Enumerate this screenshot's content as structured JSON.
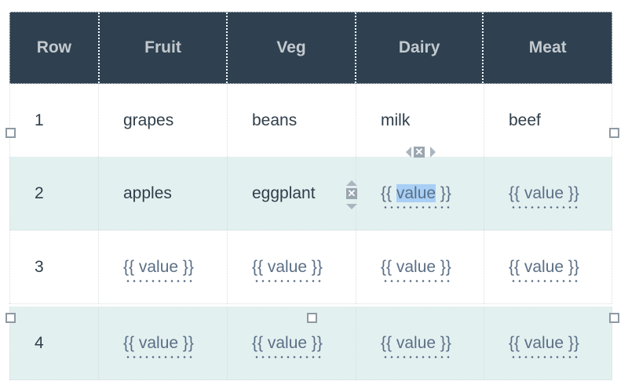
{
  "table": {
    "headers": [
      "Row",
      "Fruit",
      "Veg",
      "Dairy",
      "Meat"
    ],
    "rows": [
      [
        "1",
        "grapes",
        "beans",
        "milk",
        "beef"
      ],
      [
        "2",
        "apples",
        "eggplant",
        "{{ value }}",
        "{{ value }}"
      ],
      [
        "3",
        "{{ value }}",
        "{{ value }}",
        "{{ value }}",
        "{{ value }}"
      ],
      [
        "4",
        "{{ value }}",
        "{{ value }}",
        "{{ value }}",
        "{{ value }}"
      ]
    ],
    "selected_text": "value",
    "template_prefix": "{{ ",
    "template_suffix": " }}"
  },
  "controls": {
    "delete_glyph": "✕"
  },
  "colors": {
    "header_bg": "#2f4150",
    "header_text": "#c3c9ce",
    "alt_row_bg": "#e3f0f0",
    "template_text": "#5b6f86",
    "selection": "#a8cff5"
  }
}
